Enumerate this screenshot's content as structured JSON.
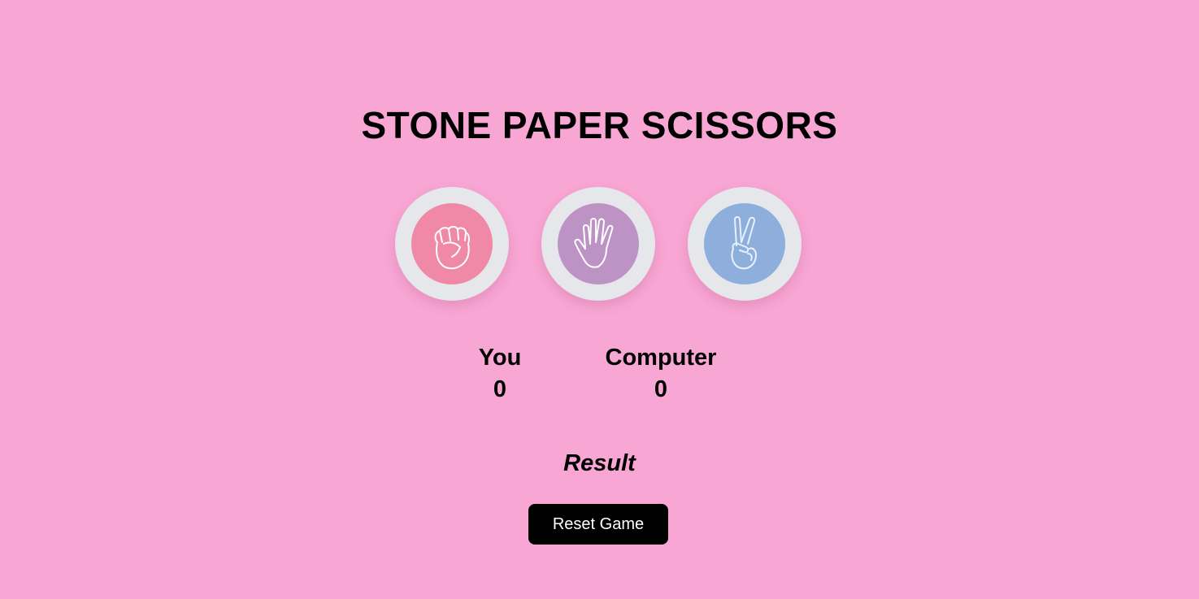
{
  "title": "STONE PAPER SCISSORS",
  "choices": [
    {
      "name": "stone",
      "icon": "fist-icon",
      "color": "#f088a8"
    },
    {
      "name": "paper",
      "icon": "open-hand-icon",
      "color": "#bc93c4"
    },
    {
      "name": "scissors",
      "icon": "peace-sign-icon",
      "color": "#8eafdc"
    }
  ],
  "scoreboard": {
    "user_label": "You",
    "user_score": "0",
    "computer_label": "Computer",
    "computer_score": "0"
  },
  "result_text": "Result",
  "reset_label": "Reset Game",
  "colors": {
    "background": "#f8a6d4",
    "choice_ring": "#e5e7eb",
    "button": "#000000"
  }
}
